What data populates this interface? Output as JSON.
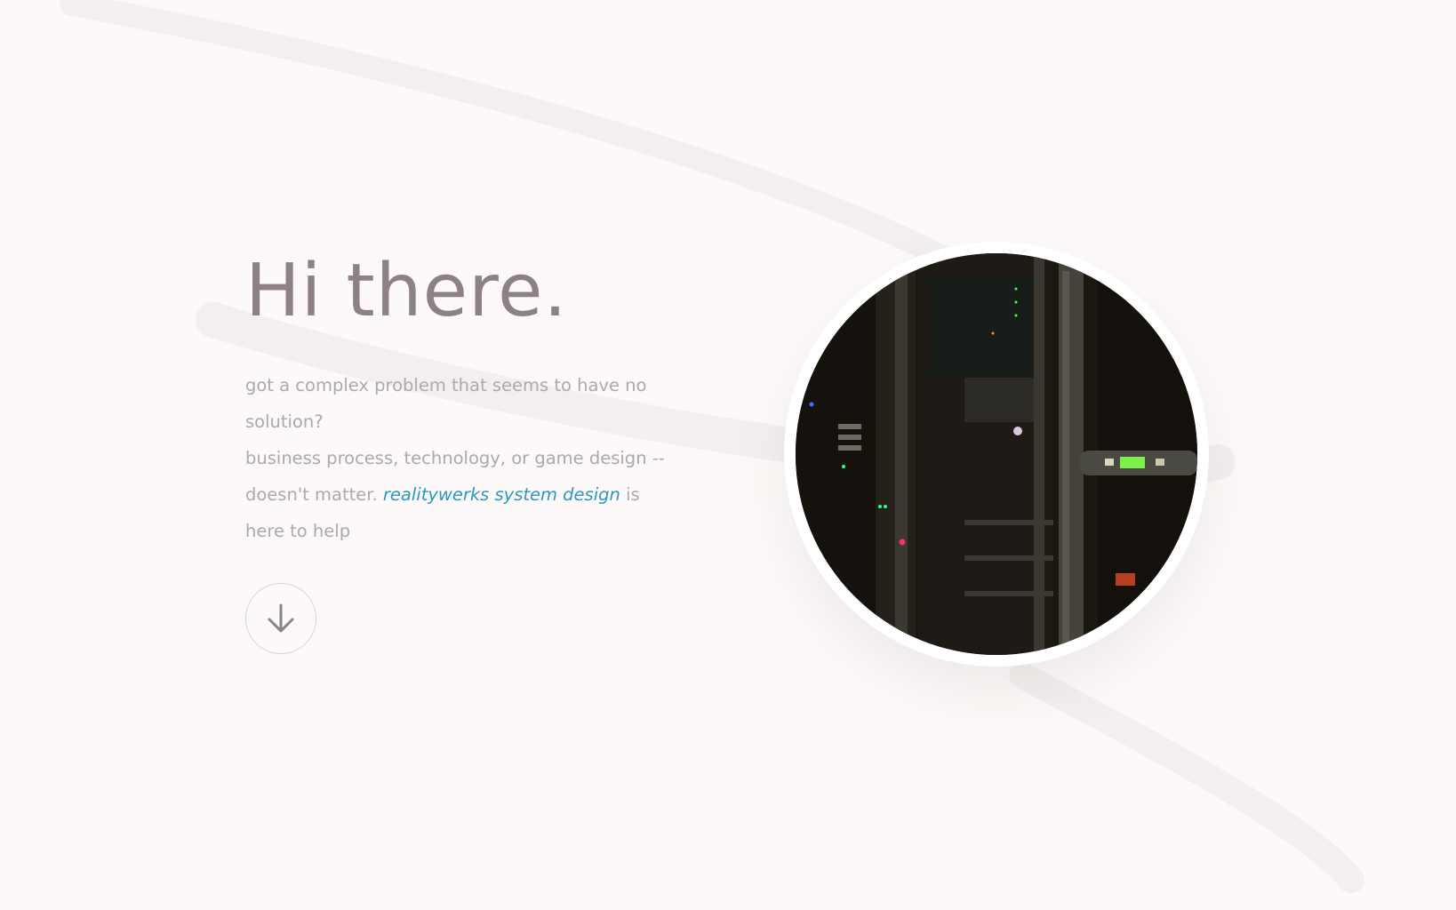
{
  "hero": {
    "title": "Hi there.",
    "intro_line1": "got a complex problem that seems to have no solution?",
    "intro_line2_before": "business process, technology, or game design -- doesn't matter.",
    "brand_link": "realitywerks system design",
    "intro_line2_after": "is here to help"
  },
  "scroll_button": {
    "icon": "arrow-down-icon"
  },
  "photo": {
    "subject": "server-rack-photo"
  },
  "colors": {
    "background": "#fcf9f8",
    "title": "#8d8183",
    "body_text": "#b0a7a8",
    "link": "#2a99bf"
  }
}
